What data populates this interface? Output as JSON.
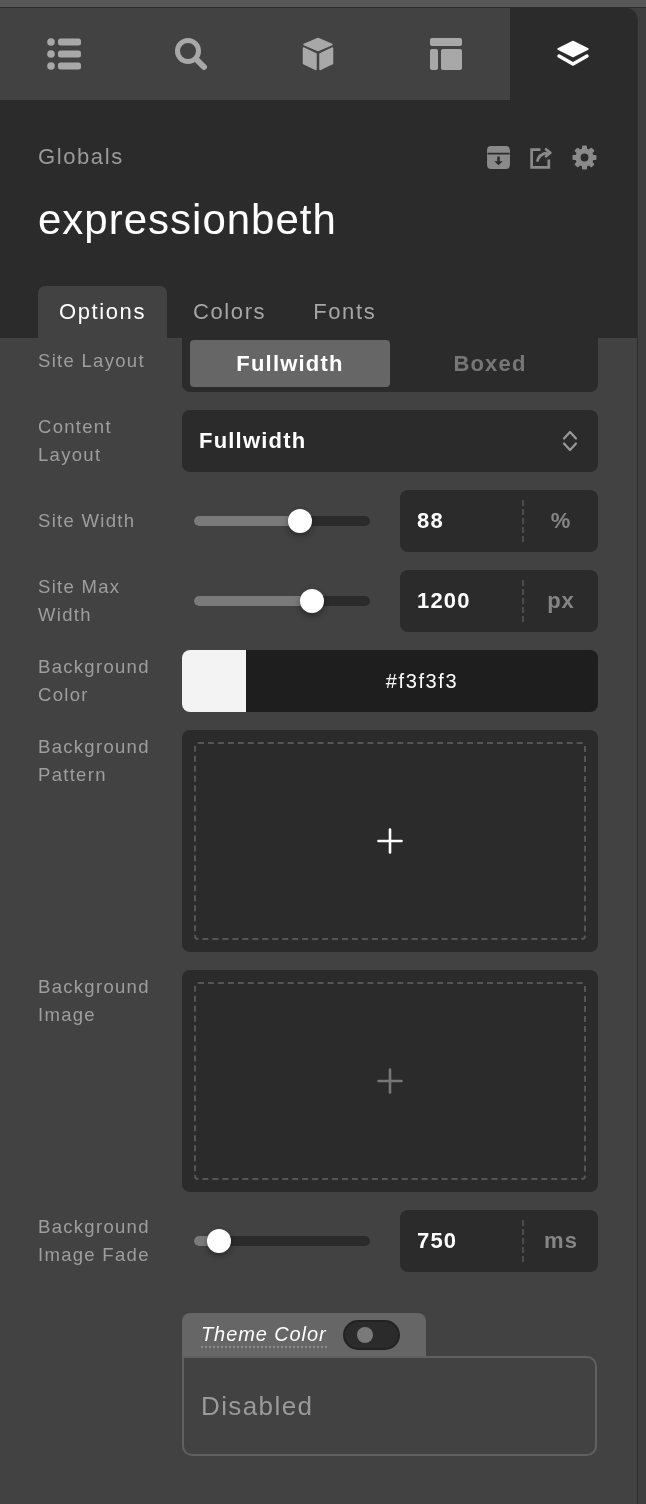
{
  "top_tabs": [
    {
      "kind": "list",
      "selected": false
    },
    {
      "kind": "search",
      "selected": false
    },
    {
      "kind": "cube",
      "selected": false
    },
    {
      "kind": "layout",
      "selected": false
    },
    {
      "kind": "layers",
      "selected": true
    }
  ],
  "header": {
    "breadcrumb": "Globals",
    "title": "expressionbeth",
    "actions": [
      {
        "kind": "archive"
      },
      {
        "kind": "export"
      },
      {
        "kind": "settings"
      }
    ]
  },
  "section_tabs": [
    {
      "label": "Options",
      "selected": true
    },
    {
      "label": "Colors",
      "selected": false
    },
    {
      "label": "Fonts",
      "selected": false
    }
  ],
  "settings": [
    {
      "kind": "segmented",
      "label": "Site Layout",
      "options": [
        {
          "label": "Fullwidth",
          "selected": true
        },
        {
          "label": "Boxed",
          "selected": false
        }
      ]
    },
    {
      "kind": "select",
      "label": "Content Layout",
      "value": "Fullwidth"
    },
    {
      "kind": "slider",
      "label": "Site Width",
      "level": 0.6,
      "value": "88",
      "unit": "%"
    },
    {
      "kind": "slider",
      "label": "Site Max Width",
      "level": 0.67,
      "value": "1200",
      "unit": "px"
    },
    {
      "kind": "color",
      "label": "Background Color",
      "color": "#f3f3f3",
      "value": "#f3f3f3"
    },
    {
      "kind": "upload",
      "label": "Background Pattern",
      "highlighted": true
    },
    {
      "kind": "upload",
      "label": "Background Image",
      "highlighted": false
    },
    {
      "kind": "slider",
      "label": "Background Image Fade",
      "level": 0.14,
      "value": "750",
      "unit": "ms"
    }
  ],
  "theme_color": {
    "label": "Theme Color",
    "on": false,
    "value": "Disabled"
  }
}
